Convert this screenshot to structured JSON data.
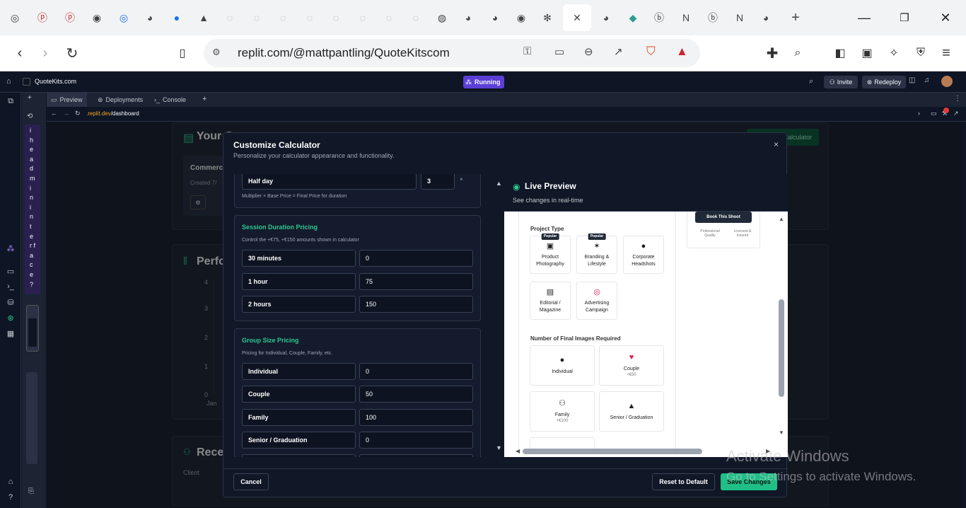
{
  "browser": {
    "active_tab_close": "✕",
    "new_tab": "+",
    "url": "replit.com/@mattpantling/QuoteKitscom"
  },
  "replit": {
    "project_name": "QuoteKits.com",
    "status": "Running",
    "invite": "Invite",
    "redeploy": "Redeploy",
    "pane_tabs": [
      "Preview",
      "Deployments",
      "Console"
    ],
    "preview_url_prefix": ".replit.dev",
    "preview_url_path": "/dashboard",
    "side_hint": "i h e a d m i n i n t e r f a c e ?"
  },
  "dashboard": {
    "title_fragment": "Your C",
    "card_title": "Commerc",
    "card_date": "Created 7/",
    "perf_title": "Perfo",
    "recent_title": "Rece",
    "col_client": "Client",
    "ticks": [
      "4",
      "3",
      "2",
      "1",
      "0"
    ],
    "x_first": "Jan",
    "create_btn": "Calculator"
  },
  "modal": {
    "title": "Customize Calculator",
    "subtitle": "Personalize your calculator appearance and functionality.",
    "close": "×",
    "half_day": {
      "label": "Half day",
      "value": "3",
      "x": "×",
      "note": "Multiplier × Base Price = Final Price for duration"
    },
    "session": {
      "title": "Session Duration Pricing",
      "desc": "Control the +€75, +€150 amounts shown in calculator",
      "rows": [
        {
          "label": "30 minutes",
          "value": "0"
        },
        {
          "label": "1 hour",
          "value": "75"
        },
        {
          "label": "2 hours",
          "value": "150"
        }
      ]
    },
    "group": {
      "title": "Group Size Pricing",
      "desc": "Pricing for Individual, Couple, Family, etc.",
      "rows": [
        {
          "label": "Individual",
          "value": "0"
        },
        {
          "label": "Couple",
          "value": "50"
        },
        {
          "label": "Family",
          "value": "100"
        },
        {
          "label": "Senior / Graduation",
          "value": "0"
        }
      ]
    },
    "preview": {
      "title": "Live Preview",
      "subtitle": "See changes in real-time",
      "project_type": "Project Type",
      "popular": "Popular",
      "types": [
        "Product Photography",
        "Branding & Lifestyle",
        "Corporate Headshots",
        "Editorial / Magazine",
        "Advertising Campaign"
      ],
      "images_label": "Number of Final Images Required",
      "groups": [
        {
          "name": "Individual",
          "price": ""
        },
        {
          "name": "Couple",
          "price": "+€50"
        },
        {
          "name": "Family",
          "price": "+€100"
        },
        {
          "name": "Senior / Graduation",
          "price": ""
        }
      ],
      "book": "Book This Shoot",
      "quality": "Professional Quality",
      "insured": "Licensed & Insured"
    },
    "cancel": "Cancel",
    "reset": "Reset to Default",
    "save": "Save Changes"
  },
  "watermark": {
    "line1": "Activate Windows",
    "line2": "Go to Settings to activate Windows."
  },
  "colors": {
    "accent": "#2ec88f",
    "running": "#5b3fd6",
    "bg": "#0e1525"
  }
}
